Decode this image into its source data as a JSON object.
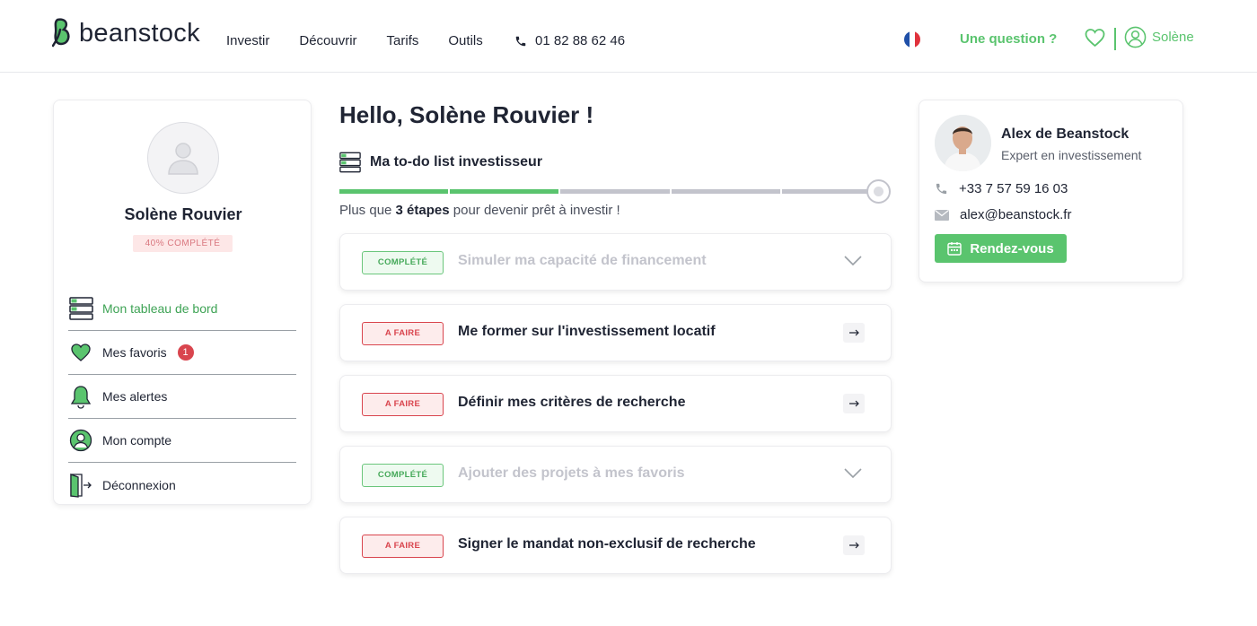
{
  "header": {
    "logo_text": "beanstock",
    "nav": [
      "Investir",
      "Découvrir",
      "Tarifs",
      "Outils"
    ],
    "phone": "01 82 88 62 46",
    "question": "Une question ?",
    "user_name": "Solène"
  },
  "profile": {
    "name": "Solène Rouvier",
    "completion": "40% COMPLÉTÉ",
    "menu": [
      {
        "label": "Mon tableau de bord",
        "icon": "dashboard-list-icon",
        "active": true
      },
      {
        "label": "Mes favoris",
        "icon": "heart-icon",
        "count": "1"
      },
      {
        "label": "Mes alertes",
        "icon": "bell-icon"
      },
      {
        "label": "Mon compte",
        "icon": "user-circle-icon"
      },
      {
        "label": "Déconnexion",
        "icon": "logout-door-icon"
      }
    ]
  },
  "main": {
    "greeting": "Hello, Solène Rouvier !",
    "todo_title": "Ma to-do list investisseur",
    "progress": {
      "completed_steps": 2,
      "total_steps": 5
    },
    "steps_prefix": "Plus que ",
    "steps_count": "3 étapes",
    "steps_suffix": " pour devenir prêt à investir !",
    "tasks": [
      {
        "status": "COMPLÉTÉ",
        "done": true,
        "label": "Simuler ma capacité de financement"
      },
      {
        "status": "A FAIRE",
        "done": false,
        "label": "Me former sur l'investissement locatif"
      },
      {
        "status": "A FAIRE",
        "done": false,
        "label": "Définir mes critères de recherche"
      },
      {
        "status": "COMPLÉTÉ",
        "done": true,
        "label": "Ajouter des projets à mes favoris"
      },
      {
        "status": "A FAIRE",
        "done": false,
        "label": "Signer le mandat non-exclusif de recherche"
      }
    ]
  },
  "advisor": {
    "name": "Alex de Beanstock",
    "role": "Expert en investissement",
    "phone": "+33 7 57 59 16 03",
    "email": "alex@beanstock.fr",
    "cta": "Rendez-vous"
  },
  "colors": {
    "brand_green": "#5ac46e",
    "todo_red": "#d9454e",
    "text_dark": "#1f2433",
    "muted_gray": "#c3c4cc"
  }
}
